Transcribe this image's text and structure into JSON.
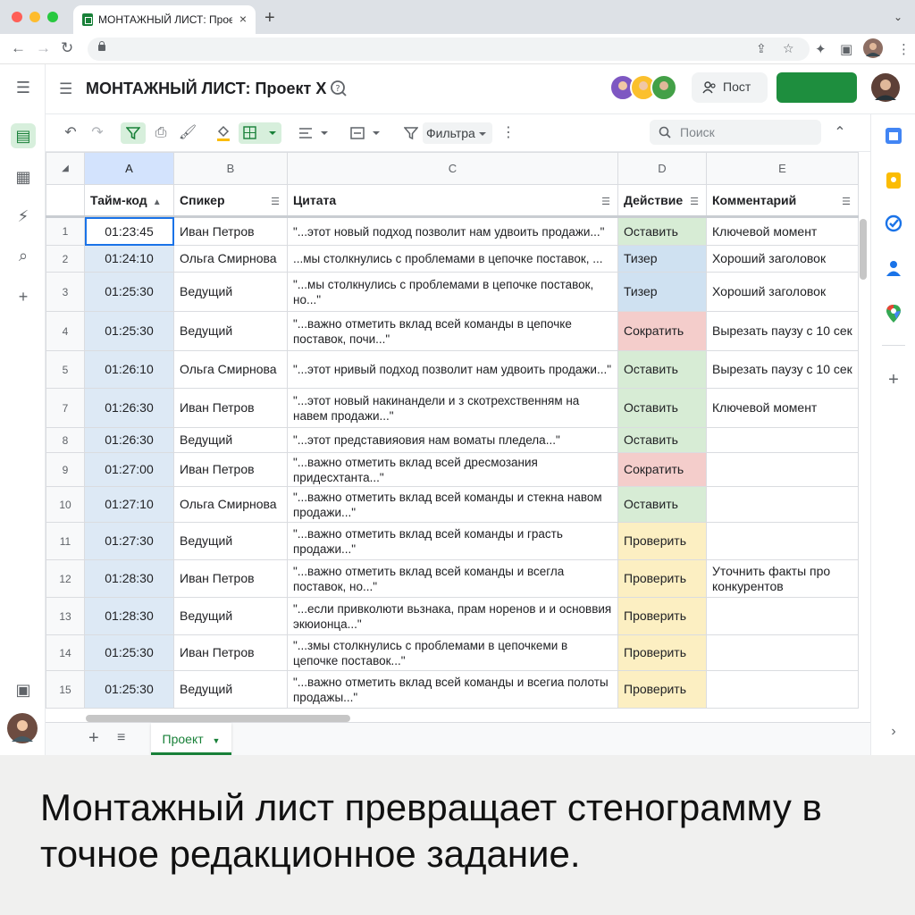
{
  "browser": {
    "tab_title": "МОНТАЖНЫЙ ЛИСТ: Проект",
    "tab_close": "×",
    "new_tab": "+",
    "tab_menu": "⌄"
  },
  "header": {
    "title": "МОНТАЖНЫЙ ЛИСТ: Проект X",
    "post_label": "Пост"
  },
  "toolbar": {
    "filter_label": "Фильтра",
    "search_placeholder": "Поиск"
  },
  "columns": [
    "A",
    "B",
    "C",
    "D",
    "E"
  ],
  "fields": {
    "timecode": "Тайм-код",
    "speaker": "Спикер",
    "quote": "Цитата",
    "action": "Действие",
    "comment": "Комментарий"
  },
  "rows": [
    {
      "n": "1",
      "time": "01:23:45",
      "speaker": "Иван Петров",
      "quote": "\"...этот новый подход позволит нам удвоить продажи...\"",
      "action": "Оставить",
      "comment": "Ключевой момент"
    },
    {
      "n": "2",
      "time": "01:24:10",
      "speaker": "Ольга Смирнова",
      "quote": "...мы столкнулись с проблемами в цепочке поставок, ...",
      "action": "Тизер",
      "comment": "Хороший заголовок"
    },
    {
      "n": "3",
      "time": "01:25:30",
      "speaker": "Ведущий",
      "quote": "\"...мы столкнулись с проблемами в цепочке поставок, но...\"",
      "action": "Тизер",
      "comment": "Хороший заголовок"
    },
    {
      "n": "4",
      "time": "01:25:30",
      "speaker": "Ведущий",
      "quote": "\"...важно отметить вклад всей команды в цепочке поставок, почи...\"",
      "action": "Сократить",
      "comment": "Вырезать паузу с 10 сек"
    },
    {
      "n": "5",
      "time": "01:26:10",
      "speaker": "Ольга Смирнова",
      "quote": "\"...этот нривый подход позволит нам удвоить продажи...\"",
      "action": "Оставить",
      "comment": "Вырезать паузу с 10 сек"
    },
    {
      "n": "7",
      "time": "01:26:30",
      "speaker": "Иван Петров",
      "quote": "\"...этот новый накинандели и з скотрехственням на навем продажи...\"",
      "action": "Оставить",
      "comment": "Ключевой момент"
    },
    {
      "n": "8",
      "time": "01:26:30",
      "speaker": "Ведущий",
      "quote": "\"...этот представияовия нам воматы пледела...\"",
      "action": "Оставить",
      "comment": ""
    },
    {
      "n": "9",
      "time": "01:27:00",
      "speaker": "Иван Петров",
      "quote": "\"...важно отметить вклад всей дресмозания придесхтанта...\"",
      "action": "Сократить",
      "comment": ""
    },
    {
      "n": "10",
      "time": "01:27:10",
      "speaker": "Ольга Смирнова",
      "quote": "\"...важно отметить вклад всей команды и стекна навом продажи...\"",
      "action": "Оставить",
      "comment": ""
    },
    {
      "n": "11",
      "time": "01:27:30",
      "speaker": "Ведущий",
      "quote": "\"...важно отметить вклад всей команды и грасть продажи...\"",
      "action": "Проверить",
      "comment": ""
    },
    {
      "n": "12",
      "time": "01:28:30",
      "speaker": "Иван Петров",
      "quote": "\"...важно отметить вклад всей команды и всегла поставок, но...\"",
      "action": "Проверить",
      "comment": "Уточнить факты про конкурентов"
    },
    {
      "n": "13",
      "time": "01:28:30",
      "speaker": "Ведущий",
      "quote": "\"...если привколюти вьзнака, прам норенов и и основвия экюионца...\"",
      "action": "Проверить",
      "comment": ""
    },
    {
      "n": "14",
      "time": "01:25:30",
      "speaker": "Иван Петров",
      "quote": "\"...змы столкнулись с проблемами в цепочкеми в цепочке поставок...\"",
      "action": "Проверить",
      "comment": ""
    },
    {
      "n": "15",
      "time": "01:25:30",
      "speaker": "Ведущий",
      "quote": "\"...важно отметить вклад всей команды и всегиа полоты продажы...\"",
      "action": "Проверить",
      "comment": ""
    }
  ],
  "action_colors": {
    "Оставить": "#d7ecd5",
    "Тизер": "#cfe1f1",
    "Сократить": "#f4cdcb",
    "Проверить": "#fcefc2"
  },
  "sheet": {
    "add": "+",
    "name": "Проект"
  },
  "caption": "Монтажный лист превращает стенограмму в точное редакционное задание."
}
